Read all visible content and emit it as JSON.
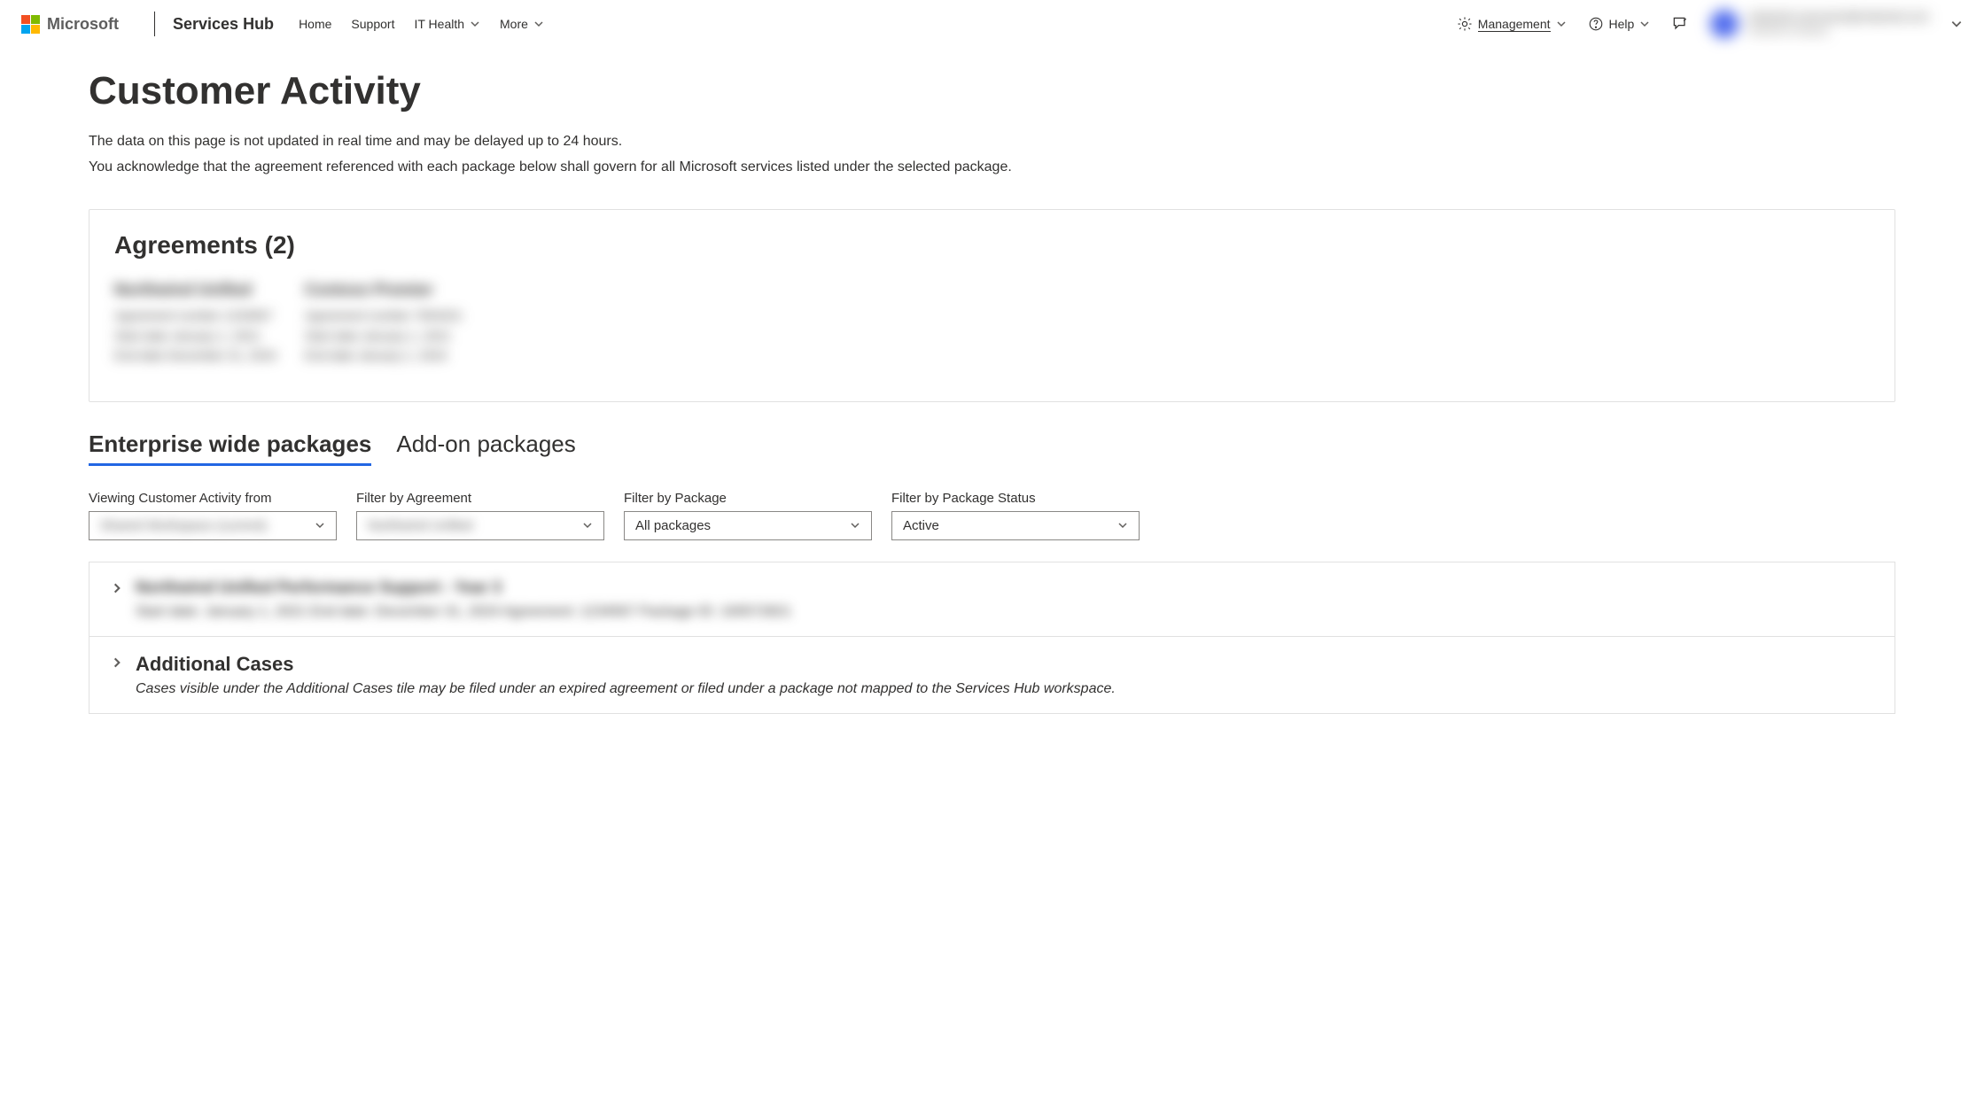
{
  "header": {
    "brand": "Microsoft",
    "sub_brand": "Services Hub",
    "nav": {
      "home": "Home",
      "support": "Support",
      "it_health": "IT Health",
      "more": "More",
      "management": "Management",
      "help": "Help"
    },
    "user": {
      "line1": "redacted-username@redacted.com",
      "line2": "redacted-company"
    }
  },
  "page": {
    "title": "Customer Activity",
    "desc_line1": "The data on this page is not updated in real time and may be delayed up to 24 hours.",
    "desc_line2": "You acknowledge that the agreement referenced with each package below shall govern for all Microsoft services listed under the selected package."
  },
  "agreements_card": {
    "title": "Agreements (2)",
    "items": [
      {
        "name": "Northwind Unified",
        "line1": "Agreement number 1234567",
        "line2": "Start date January 1, 2021",
        "line3": "End date December 31, 2024"
      },
      {
        "name": "Contoso Premier",
        "line1": "Agreement number 7654321",
        "line2": "Start date January 1, 2021",
        "line3": "End date January 1, 2024"
      }
    ]
  },
  "tabs": {
    "enterprise": "Enterprise wide packages",
    "addon": "Add-on packages"
  },
  "filters": {
    "viewing_label": "Viewing Customer Activity from",
    "viewing_value": "Shared Workspace (current)",
    "agreement_label": "Filter by Agreement",
    "agreement_value": "Northwind Unified",
    "package_label": "Filter by Package",
    "package_value": "All packages",
    "status_label": "Filter by Package Status",
    "status_value": "Active"
  },
  "packages": {
    "row1": {
      "title": "Northwind Unified Performance Support - Year 3",
      "meta": "Start date: January 1, 2021   End date: December 31, 2024   Agreement: 1234567   Package ID: 100572821"
    },
    "row2": {
      "title": "Additional Cases",
      "desc": "Cases visible under the Additional Cases tile may be filed under an expired agreement or filed under a package not mapped to the Services Hub workspace."
    }
  }
}
